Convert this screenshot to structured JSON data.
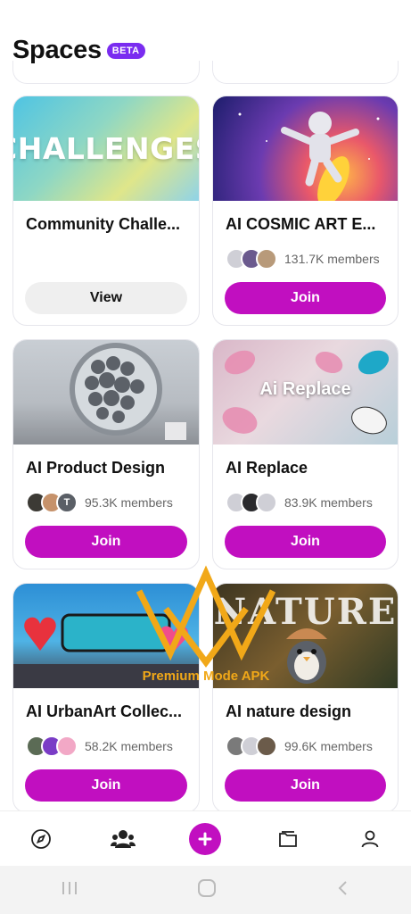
{
  "header": {
    "title": "Spaces",
    "badge": "BETA"
  },
  "cards": [
    {
      "title": "Community Challe...",
      "thumb_text": "CHALLENGES",
      "button": "View"
    },
    {
      "title": "AI COSMIC ART E...",
      "members": "131.7K members",
      "button": "Join"
    },
    {
      "title": "AI Product Design",
      "members": "95.3K members",
      "avatar_letter": "T",
      "button": "Join"
    },
    {
      "title": "AI Replace",
      "members": "83.9K members",
      "thumb_text": "Ai Replace",
      "button": "Join"
    },
    {
      "title": "AI UrbanArt Collec...",
      "members": "58.2K members",
      "button": "Join"
    },
    {
      "title": "AI nature design",
      "members": "99.6K members",
      "thumb_text": "NATURE",
      "button": "Join"
    }
  ],
  "watermark": {
    "text": "Premium Mode APK"
  },
  "tabbar": [
    "explore-icon",
    "community-icon",
    "create-plus-icon",
    "collections-icon",
    "profile-icon"
  ],
  "colors": {
    "accent": "#c10fc0",
    "badge": "#7a2cf0"
  }
}
